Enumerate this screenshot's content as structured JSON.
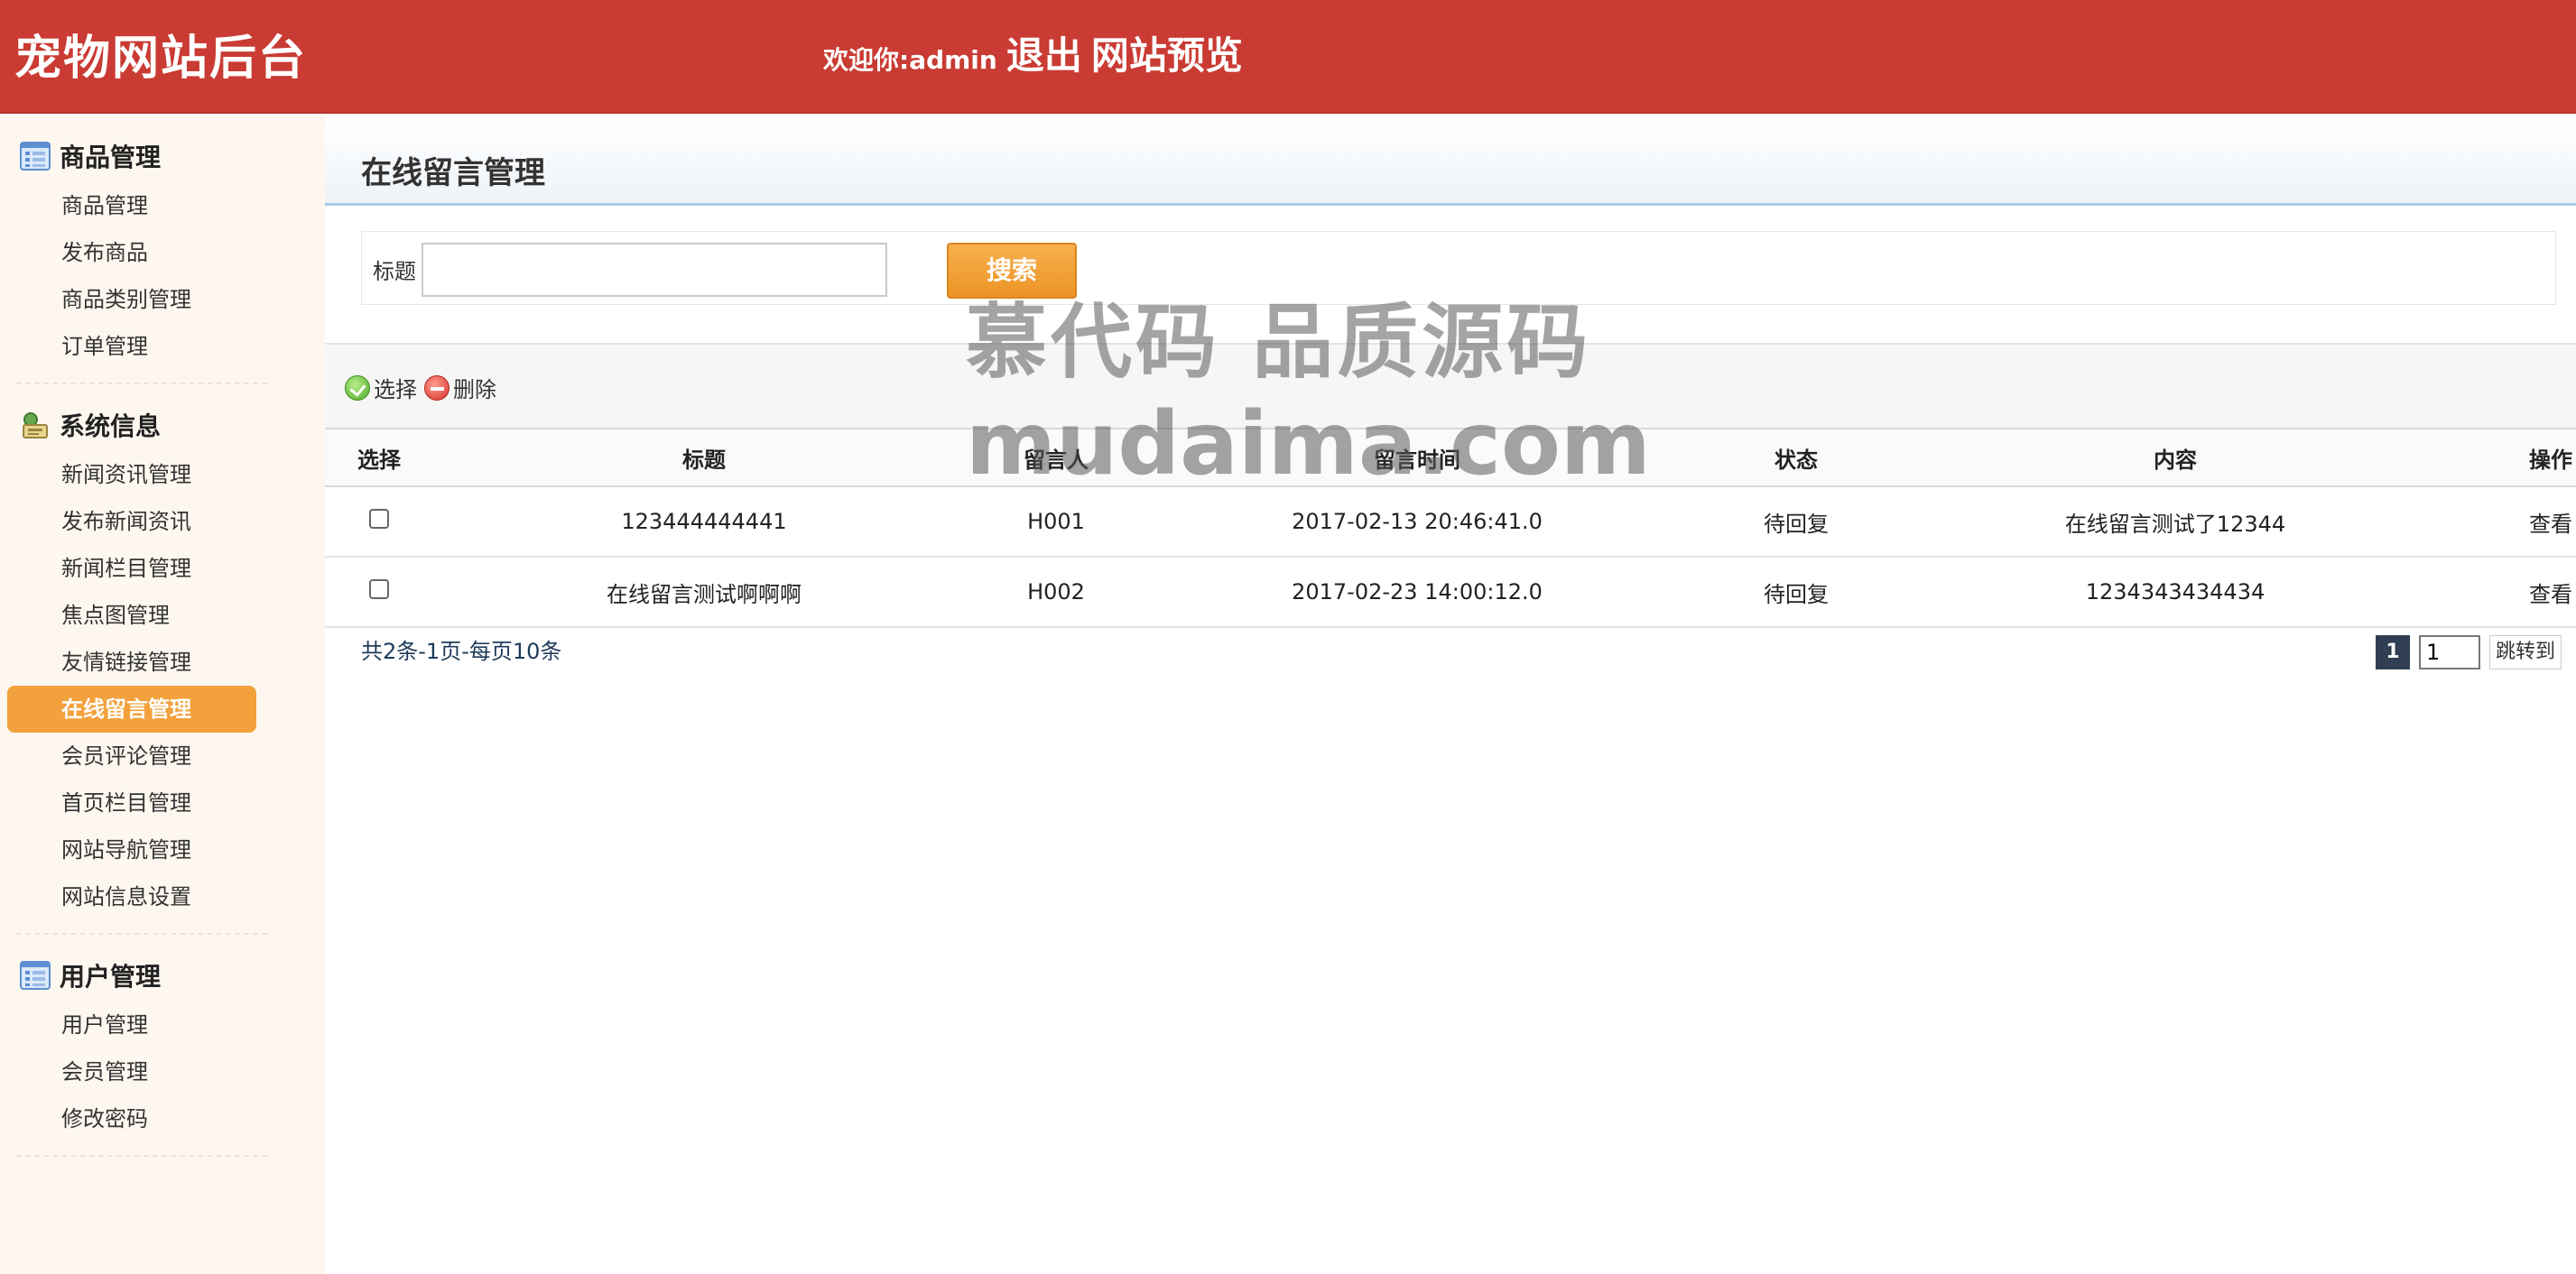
{
  "header": {
    "brand": "宠物网站后台",
    "welcome": "欢迎你:admin",
    "logout": "退出",
    "preview": "网站预览"
  },
  "sidebar": {
    "groups": [
      {
        "title": "商品管理",
        "items": [
          "商品管理",
          "发布商品",
          "商品类别管理",
          "订单管理"
        ]
      },
      {
        "title": "系统信息",
        "items": [
          "新闻资讯管理",
          "发布新闻资讯",
          "新闻栏目管理",
          "焦点图管理",
          "友情链接管理",
          "在线留言管理",
          "会员评论管理",
          "首页栏目管理",
          "网站导航管理",
          "网站信息设置"
        ]
      },
      {
        "title": "用户管理",
        "items": [
          "用户管理",
          "会员管理",
          "修改密码"
        ]
      }
    ],
    "active_item": "在线留言管理"
  },
  "main": {
    "title": "在线留言管理",
    "search": {
      "label": "标题",
      "value": "",
      "button": "搜索"
    },
    "toolbar": {
      "select": "选择",
      "delete": "删除"
    },
    "table": {
      "headers": [
        "选择",
        "标题",
        "留言人",
        "留言时间",
        "状态",
        "内容",
        "操作"
      ],
      "rows": [
        {
          "title": "123444444441",
          "user": "H001",
          "time": "2017-02-13 20:46:41.0",
          "status": "待回复",
          "content": "在线留言测试了12344",
          "action": "查看"
        },
        {
          "title": "在线留言测试啊啊啊",
          "user": "H002",
          "time": "2017-02-23 14:00:12.0",
          "status": "待回复",
          "content": "1234343434434",
          "action": "查看"
        }
      ]
    },
    "pagination": {
      "summary": "共2条-1页-每页10条",
      "current_page": "1",
      "jump_value": "1",
      "jump_label": "跳转到"
    }
  },
  "watermark": {
    "line1": "慕代码 品质源码",
    "line2": "mudaima.com"
  },
  "colors": {
    "header": "#c93b33",
    "active": "#f3a13c",
    "sidebar_bg": "#fdf7ef"
  }
}
